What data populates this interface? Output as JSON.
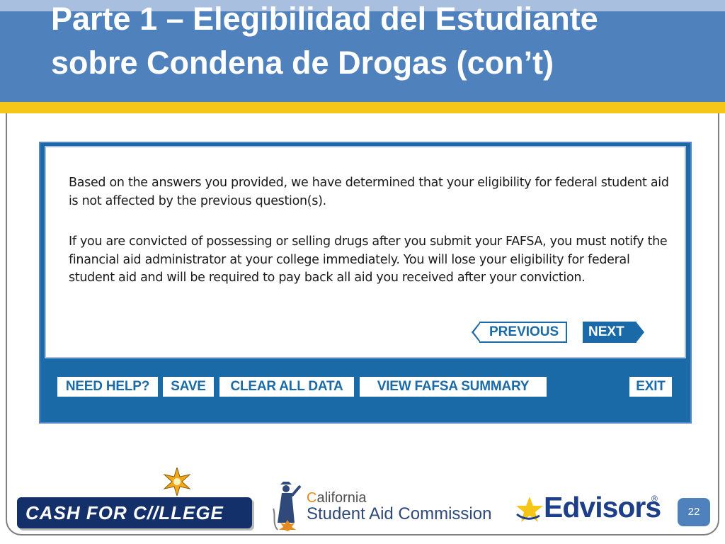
{
  "slide": {
    "title": "Parte 1 – Elegibilidad del Estudiante sobre Condena de Drogas (con’t)",
    "page_number": "22"
  },
  "screen": {
    "message_1": "Based on the answers you provided, we have determined that your eligibility for federal student aid is not affected by the previous question(s).",
    "message_2": "If you are convicted of possessing or selling drugs after you submit your FAFSA, you must notify the financial aid administrator at your college immediately. You will lose your eligibility for federal student aid and will be required to pay back all aid you received after your conviction.",
    "nav": {
      "previous": "PREVIOUS",
      "next": "NEXT"
    },
    "toolbar": {
      "need_help": "NEED HELP?",
      "save": "SAVE",
      "clear_all_data": "CLEAR ALL DATA",
      "view_fafsa_summary": "VIEW FAFSA SUMMARY",
      "exit": "EXIT"
    }
  },
  "logos": {
    "cash_for_college": "CASH FOR C//LLEGE",
    "csac_line1_prefix": "C",
    "csac_line1_rest": "alifornia",
    "csac_line2": "Student Aid Commission",
    "edvisors": "Edvisors",
    "edvisors_reg": "®"
  },
  "icons": [
    "sunburst-star-icon",
    "graduate-figure-icon",
    "gold-star-icon"
  ],
  "colors": {
    "title_band": "#4f81bd",
    "accent_bar": "#f5c518",
    "fafsa_blue": "#1b6aa8",
    "edvisors_blue": "#1d3f8a"
  }
}
